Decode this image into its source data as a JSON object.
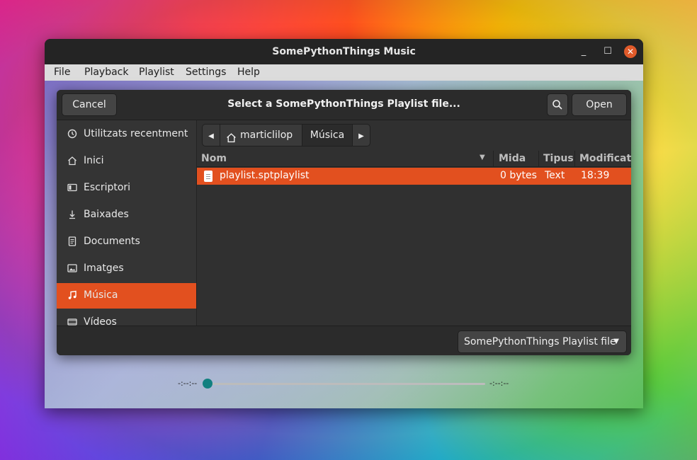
{
  "window": {
    "title": "SomePythonThings Music",
    "controls": {
      "minimize": "_",
      "maximize": "☐",
      "close": "✕"
    }
  },
  "menubar": {
    "items": [
      "File",
      "Playback",
      "Playlist",
      "Settings",
      "Help"
    ]
  },
  "player": {
    "time_left": "-:--:--",
    "time_right": "-:--:--",
    "progress": 0
  },
  "dialog": {
    "title": "Select a SomePythonThings Playlist file...",
    "cancel_label": "Cancel",
    "open_label": "Open",
    "search_icon": "search-icon",
    "sidebar": [
      {
        "label": "Utilitzats recentment",
        "icon": "clock-icon"
      },
      {
        "label": "Inici",
        "icon": "home-icon"
      },
      {
        "label": "Escriptori",
        "icon": "desktop-icon"
      },
      {
        "label": "Baixades",
        "icon": "download-icon"
      },
      {
        "label": "Documents",
        "icon": "document-icon"
      },
      {
        "label": "Imatges",
        "icon": "image-icon"
      },
      {
        "label": "Música",
        "icon": "music-icon",
        "active": true
      },
      {
        "label": "Vídeos",
        "icon": "video-icon"
      }
    ],
    "path": {
      "home": "marticlilop",
      "current": "Música"
    },
    "columns": {
      "name": "Nom",
      "size": "Mida",
      "type": "Tipus",
      "modified": "Modificat"
    },
    "files": [
      {
        "name": "playlist.sptplaylist",
        "size": "0 bytes",
        "type": "Text",
        "modified": "18:39",
        "selected": true
      }
    ],
    "filter": {
      "value": "SomePythonThings Playlist file"
    }
  },
  "colors": {
    "accent": "#e2501f",
    "dialog_bg": "#303030",
    "titlebar_bg": "#242424",
    "menubar_bg": "#dcdcdc"
  }
}
